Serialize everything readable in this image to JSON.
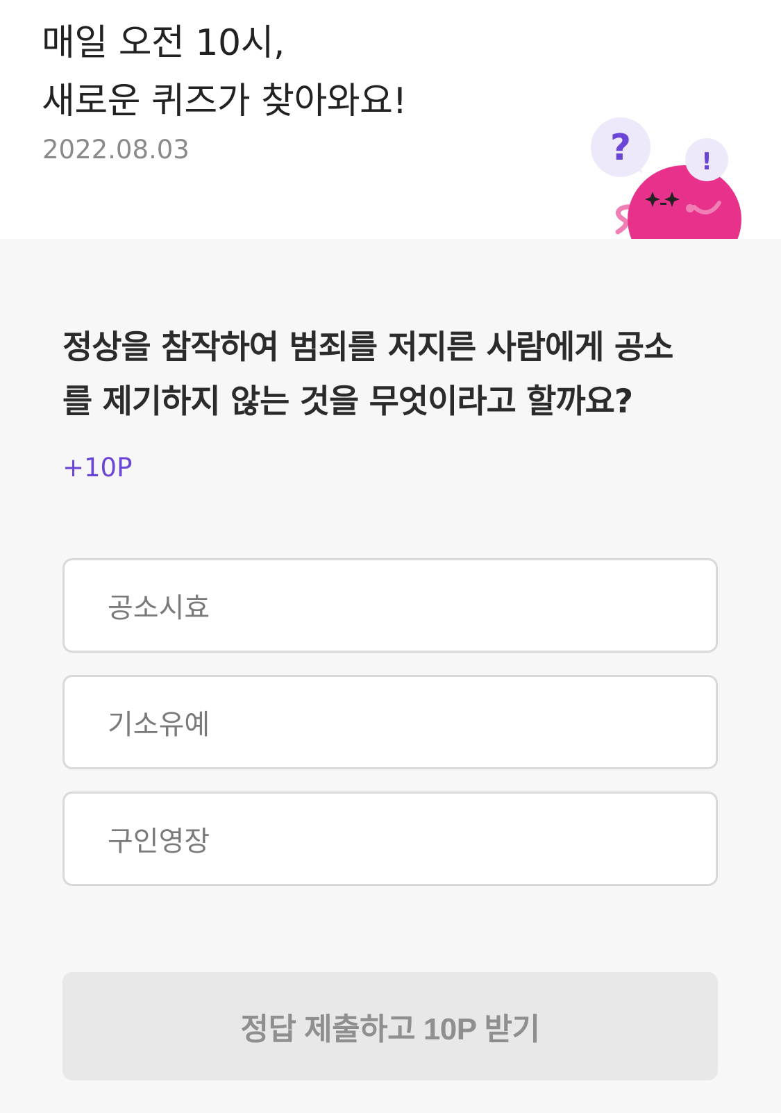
{
  "header": {
    "title_line1": "매일 오전 10시,",
    "title_line2": "새로운 퀴즈가 찾아와요!",
    "date": "2022.08.03"
  },
  "mascot": {
    "question_mark": "?",
    "exclamation_mark": "!",
    "body_color": "#e8318a",
    "bubble_color": "#ede9fb",
    "accent_color": "#6b45d6"
  },
  "quiz": {
    "question_line1": "정상을 참작하여 범죄를 저지른 사람에게 공소",
    "question_line2": "를 제기하지 않는 것을 무엇이라고 할까요?",
    "points": "+10P",
    "options": [
      {
        "label": "공소시효"
      },
      {
        "label": "기소유예"
      },
      {
        "label": "구인영장"
      }
    ],
    "submit_label": "정답 제출하고 10P 받기"
  }
}
